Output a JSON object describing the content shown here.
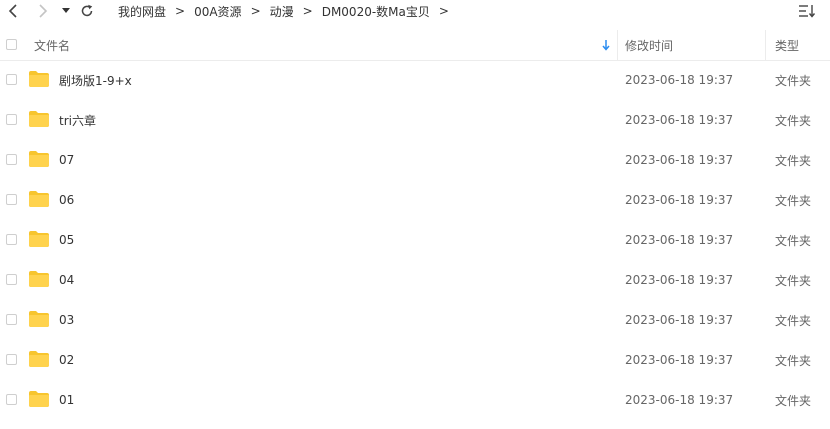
{
  "toolbar": {
    "back_icon": "chevron-left-icon",
    "forward_icon": "chevron-right-icon",
    "history_icon": "caret-down-icon",
    "refresh_icon": "refresh-icon",
    "sort_icon": "sort-list-icon"
  },
  "breadcrumb": {
    "items": [
      "我的网盘",
      "00A资源",
      "动漫",
      "DM0020-数Ma宝贝"
    ],
    "separator": ">"
  },
  "header": {
    "name": "文件名",
    "date": "修改时间",
    "type": "类型"
  },
  "colors": {
    "folder": "#ffd34e",
    "folder_tab": "#f7c52e",
    "sort_arrow": "#2b8cf0"
  },
  "rows": [
    {
      "name": "剧场版1-9+x",
      "date": "2023-06-18 19:37",
      "type": "文件夹"
    },
    {
      "name": "tri六章",
      "date": "2023-06-18 19:37",
      "type": "文件夹"
    },
    {
      "name": "07",
      "date": "2023-06-18 19:37",
      "type": "文件夹"
    },
    {
      "name": "06",
      "date": "2023-06-18 19:37",
      "type": "文件夹"
    },
    {
      "name": "05",
      "date": "2023-06-18 19:37",
      "type": "文件夹"
    },
    {
      "name": "04",
      "date": "2023-06-18 19:37",
      "type": "文件夹"
    },
    {
      "name": "03",
      "date": "2023-06-18 19:37",
      "type": "文件夹"
    },
    {
      "name": "02",
      "date": "2023-06-18 19:37",
      "type": "文件夹"
    },
    {
      "name": "01",
      "date": "2023-06-18 19:37",
      "type": "文件夹"
    }
  ]
}
